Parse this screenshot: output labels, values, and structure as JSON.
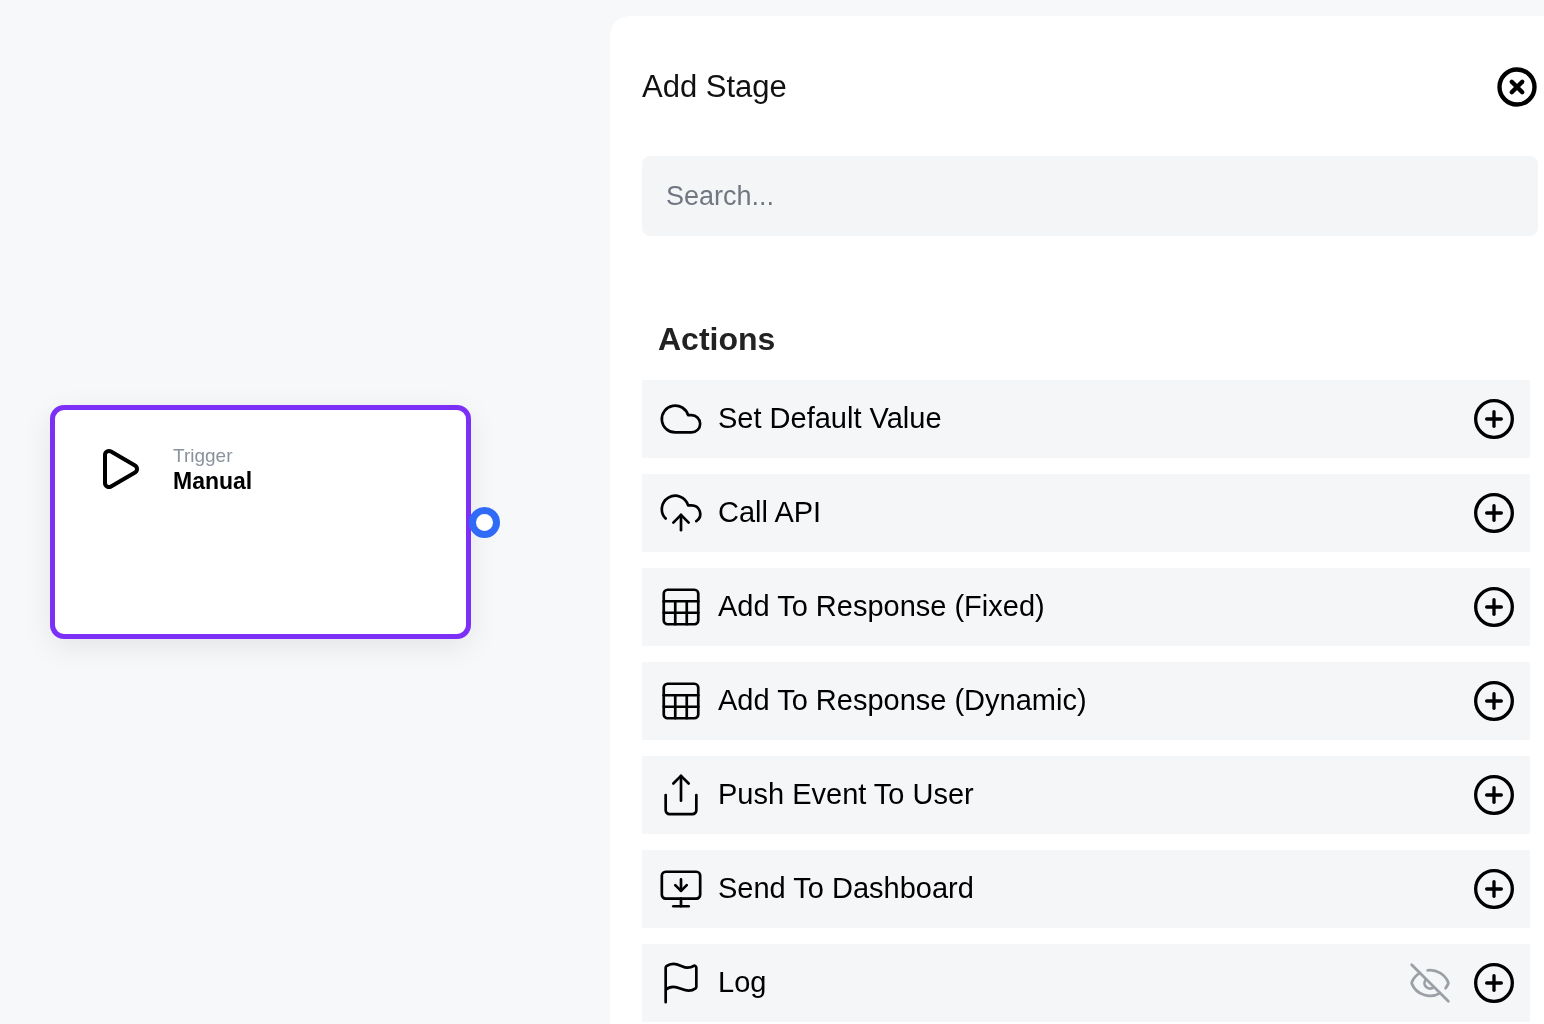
{
  "node": {
    "type_label": "Trigger",
    "title": "Manual",
    "selected": true
  },
  "panel": {
    "title": "Add Stage",
    "search": {
      "placeholder": "Search..."
    },
    "section": "Actions",
    "items": [
      {
        "label": "Set Default Value",
        "kind": "cloud",
        "hidden": false
      },
      {
        "label": "Call API",
        "kind": "cloud-upload",
        "hidden": false
      },
      {
        "label": "Add To Response (Fixed)",
        "kind": "table",
        "hidden": false
      },
      {
        "label": "Add To Response (Dynamic)",
        "kind": "table",
        "hidden": false
      },
      {
        "label": "Push Event To User",
        "kind": "share",
        "hidden": false
      },
      {
        "label": "Send To Dashboard",
        "kind": "monitor",
        "hidden": false
      },
      {
        "label": "Log",
        "kind": "flag",
        "hidden": true
      }
    ]
  }
}
